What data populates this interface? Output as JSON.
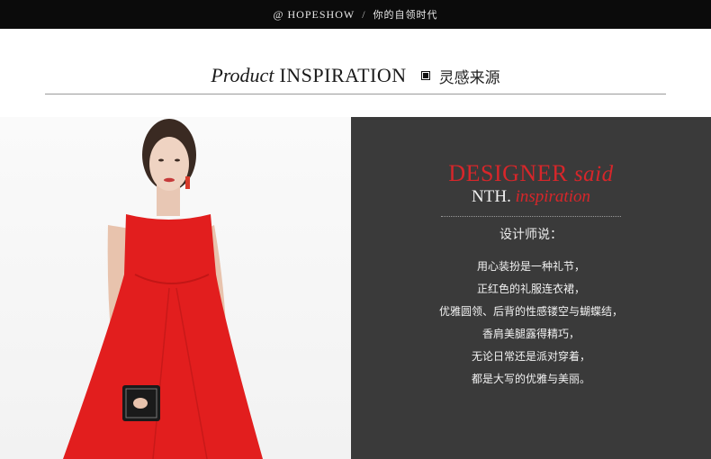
{
  "topbar": {
    "at": "@",
    "brand": "HOPESHOW",
    "sep": "/",
    "slogan": "你的自领时代"
  },
  "section": {
    "italic": "Product",
    "caps": "INSPIRATION",
    "cn": "灵感来源"
  },
  "designer": {
    "line1_caps": "DESIGNER",
    "line1_italic": "said",
    "line2_caps": "NTH.",
    "line2_italic": "inspiration",
    "said_label": "设计师说：",
    "lines": [
      "用心装扮是一种礼节，",
      "正红色的礼服连衣裙，",
      "优雅圆领、后背的性感镂空与蝴蝶结，",
      "香肩美腿露得精巧，",
      "无论日常还是派对穿着，",
      "都是大写的优雅与美丽。"
    ]
  },
  "colors": {
    "accent_red": "#d7262a",
    "dress_red": "#e21e1e",
    "panel_bg": "#3a3a3a",
    "topbar_bg": "#0b0b0b"
  }
}
